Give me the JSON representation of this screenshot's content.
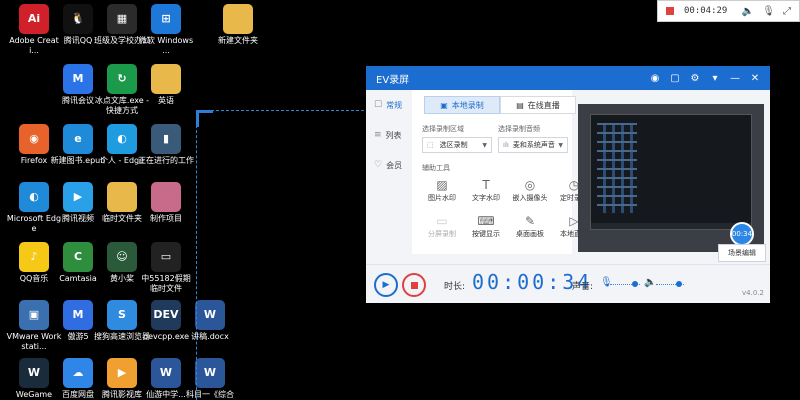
{
  "desktop": {
    "icons": [
      {
        "label": "Adobe Creati...",
        "glyph": "Ai",
        "color": "#d0202a"
      },
      {
        "label": "腾讯QQ",
        "glyph": "🐧",
        "color": "#111111"
      },
      {
        "label": "班级及学校办公",
        "glyph": "▦",
        "color": "#2b2b2b"
      },
      {
        "label": "微软 Windows ...",
        "glyph": "⊞",
        "color": "#1e78d7"
      },
      {
        "label": "新建文件夹",
        "glyph": "",
        "color": "#e8b84a"
      },
      {
        "label": "腾讯会议",
        "glyph": "M",
        "color": "#2a74e8"
      },
      {
        "label": "冰点文库.exe - 快捷方式",
        "glyph": "↻",
        "color": "#1a9a4a"
      },
      {
        "label": "英语",
        "glyph": "",
        "color": "#e8b84a"
      },
      {
        "label": "Firefox",
        "glyph": "◉",
        "color": "#e8632b"
      },
      {
        "label": "新建图书.epub",
        "glyph": "e",
        "color": "#1f8ad8"
      },
      {
        "label": "个人 - Edge",
        "glyph": "◐",
        "color": "#1f9be0"
      },
      {
        "label": "正在进行的工作",
        "glyph": "▮",
        "color": "#3a5a7a"
      },
      {
        "label": "Microsoft Edge",
        "glyph": "◐",
        "color": "#1f8ad8"
      },
      {
        "label": "腾讯视频",
        "glyph": "▶",
        "color": "#29a0e8"
      },
      {
        "label": "临时文件夹",
        "glyph": "",
        "color": "#e8b84a"
      },
      {
        "label": "制作项目",
        "glyph": "",
        "color": "#c86b8a"
      },
      {
        "label": "QQ音乐",
        "glyph": "♪",
        "color": "#f5c915"
      },
      {
        "label": "Camtasia",
        "glyph": "C",
        "color": "#2e8e3e"
      },
      {
        "label": "黄小桨",
        "glyph": "☺",
        "color": "#2a5a3a"
      },
      {
        "label": "中55182假期临时文件",
        "glyph": "▭",
        "color": "#222222"
      },
      {
        "label": "VMware Workstati...",
        "glyph": "▣",
        "color": "#3a6fb0"
      },
      {
        "label": "傲游5",
        "glyph": "M",
        "color": "#2f6de0"
      },
      {
        "label": "搜狗高速浏览器",
        "glyph": "S",
        "color": "#2e8be0"
      },
      {
        "label": "devcpp.exe",
        "glyph": "DEV",
        "color": "#1f3a5a"
      },
      {
        "label": "讲稿.docx",
        "glyph": "W",
        "color": "#2b579a"
      },
      {
        "label": "WeGame",
        "glyph": "W",
        "color": "#1a2b3c"
      },
      {
        "label": "百度网盘",
        "glyph": "☁",
        "color": "#2f86e6"
      },
      {
        "label": "腾讯影视库",
        "glyph": "▶",
        "color": "#f0a030"
      },
      {
        "label": "仙游中学...",
        "glyph": "W",
        "color": "#2b579a"
      },
      {
        "label": "科目一《综合",
        "glyph": "W",
        "color": "#2b579a"
      }
    ]
  },
  "minibar": {
    "time": "00:04:29",
    "icons": [
      "speaker-icon",
      "mic-icon",
      "expand-icon"
    ]
  },
  "ev": {
    "title": "EV录屏",
    "sidebar": [
      {
        "label": "常规",
        "icon": "☐"
      },
      {
        "label": "列表",
        "icon": "≡"
      },
      {
        "label": "会员",
        "icon": "♡"
      }
    ],
    "tabs": {
      "local": "本地录制",
      "live": "在线直播"
    },
    "region_label": "选择录制区域",
    "region_value": "选区录制",
    "audio_label": "选择录制音频",
    "audio_value": "麦和系统声音",
    "tools_label": "辅助工具",
    "tools": [
      {
        "label": "图片水印",
        "icon": "▨",
        "enabled": true
      },
      {
        "label": "文字水印",
        "icon": "T",
        "enabled": true
      },
      {
        "label": "嵌入摄像头",
        "icon": "◎",
        "enabled": true
      },
      {
        "label": "定时录制",
        "icon": "◷",
        "enabled": true
      },
      {
        "label": "分屏录制",
        "icon": "▭",
        "enabled": false
      },
      {
        "label": "按键显示",
        "icon": "⌨",
        "enabled": true
      },
      {
        "label": "桌面画板",
        "icon": "✎",
        "enabled": true
      },
      {
        "label": "本地直播",
        "icon": "▷",
        "enabled": true
      }
    ],
    "preview_badge": "00:34",
    "scene_button": "场景编辑",
    "time_label": "时长:",
    "timer": "00:00:34",
    "audio_bar_label": "声音:",
    "version": "v4.0.2"
  }
}
